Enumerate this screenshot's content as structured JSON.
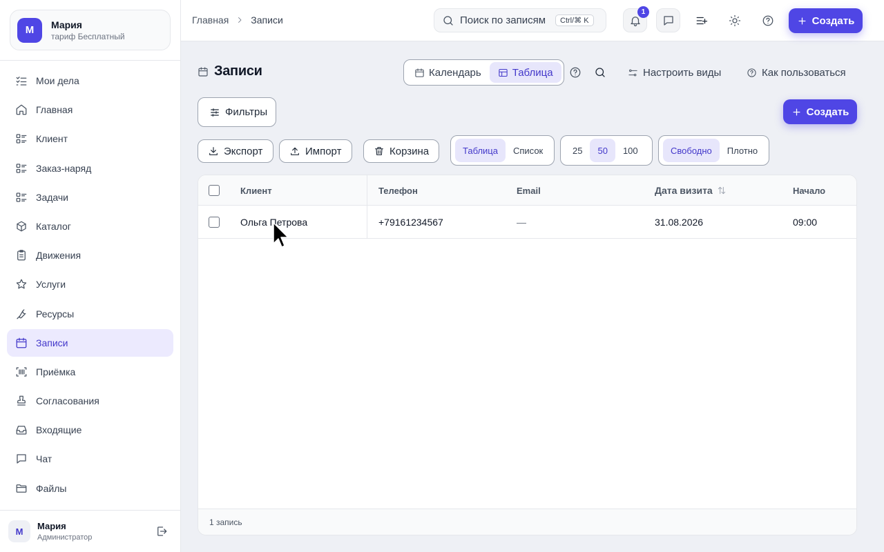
{
  "account": {
    "avatar_letter": "М",
    "name": "Мария",
    "plan": "тариф Бесплатный"
  },
  "sidebar": {
    "items": [
      {
        "label": "Мои дела",
        "icon": "list-check-icon"
      },
      {
        "label": "Главная",
        "icon": "home-icon"
      },
      {
        "label": "Клиент",
        "icon": "list-icon"
      },
      {
        "label": "Заказ-наряд",
        "icon": "list-icon"
      },
      {
        "label": "Задачи",
        "icon": "list-icon"
      },
      {
        "label": "Каталог",
        "icon": "box-icon"
      },
      {
        "label": "Движения",
        "icon": "clipboard-icon"
      },
      {
        "label": "Услуги",
        "icon": "star-icon"
      },
      {
        "label": "Ресурсы",
        "icon": "wrench-icon"
      },
      {
        "label": "Записи",
        "icon": "calendar-icon",
        "active": true
      },
      {
        "label": "Приёмка",
        "icon": "barcode-icon"
      },
      {
        "label": "Согласования",
        "icon": "stamp-icon"
      },
      {
        "label": "Входящие",
        "icon": "inbox-icon"
      },
      {
        "label": "Чат",
        "icon": "chat-icon"
      },
      {
        "label": "Файлы",
        "icon": "folder-icon"
      }
    ]
  },
  "user": {
    "avatar_letter": "М",
    "name": "Мария",
    "role": "Администратор"
  },
  "topbar": {
    "breadcrumb": [
      "Главная",
      "Записи"
    ],
    "search_placeholder": "Поиск по записям",
    "shortcut": "Ctrl/⌘ K",
    "notification_count": "1",
    "create_label": "Создать"
  },
  "page": {
    "title": "Записи",
    "views": {
      "calendar": "Календарь",
      "table": "Таблица"
    },
    "configure_views": "Настроить виды",
    "how_to_use": "Как пользоваться",
    "filters": "Фильтры",
    "create": "Создать",
    "export": "Экспорт",
    "import": "Импорт",
    "trash": "Корзина",
    "mode_options": [
      "Таблица",
      "Список"
    ],
    "page_sizes": [
      "25",
      "50",
      "100"
    ],
    "density_options": [
      "Свободно",
      "Плотно"
    ]
  },
  "table": {
    "columns": [
      "Клиент",
      "Телефон",
      "Email",
      "Дата визита",
      "Начало"
    ],
    "rows": [
      {
        "client": "Ольга Петрова",
        "phone": "+79161234567",
        "email": "—",
        "visit_date": "31.08.2026",
        "start": "09:00"
      }
    ],
    "footer": "1 запись"
  },
  "colors": {
    "accent": "#4f46e5",
    "active_bg": "#eceafe"
  }
}
